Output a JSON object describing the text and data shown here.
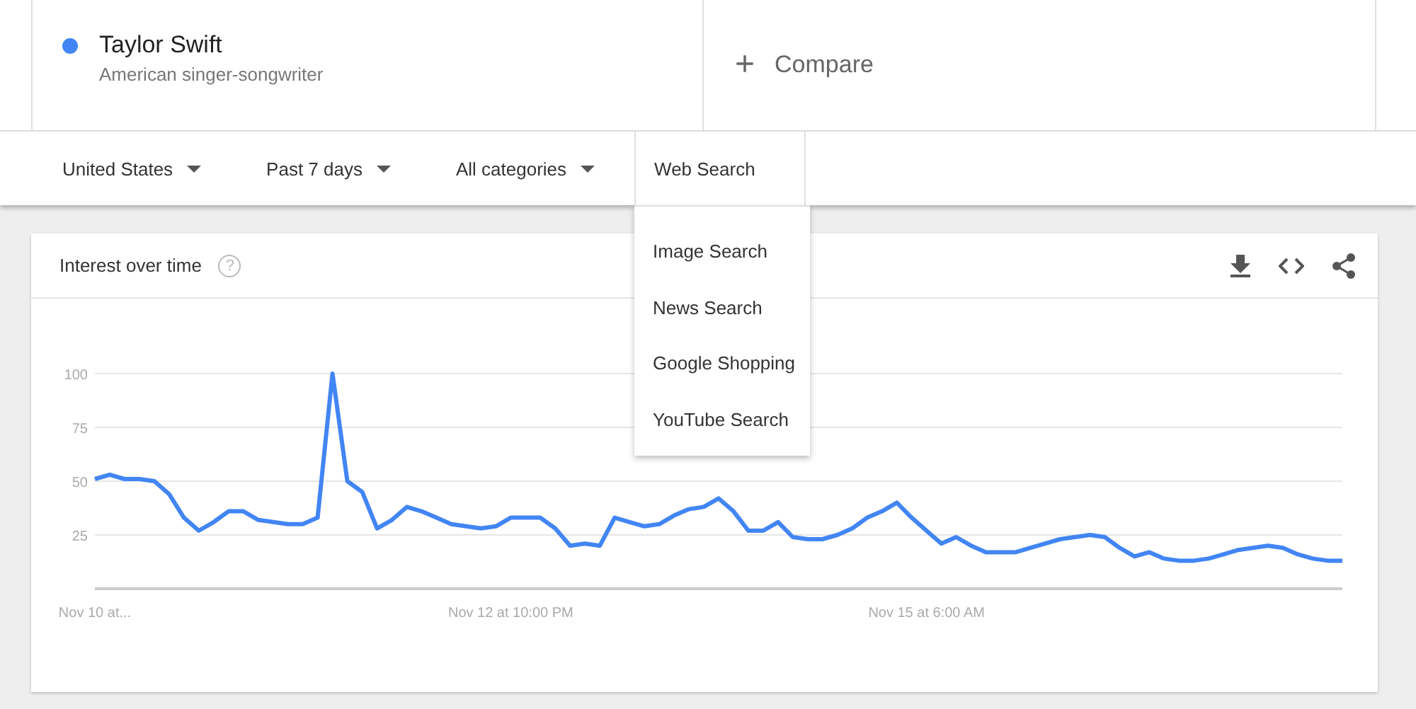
{
  "term": {
    "title": "Taylor Swift",
    "subtitle": "American singer-songwriter",
    "color": "#4285f4"
  },
  "compare": {
    "label": "Compare",
    "icon": "+"
  },
  "filters": [
    {
      "label": "United States"
    },
    {
      "label": "Past 7 days"
    },
    {
      "label": "All categories"
    }
  ],
  "search_type": {
    "value": "Web Search",
    "expanded": true,
    "options": [
      {
        "label": "Image Search",
        "selected": false
      },
      {
        "label": "News Search",
        "selected": false
      },
      {
        "label": "Google Shopping",
        "selected": false
      },
      {
        "label": "YouTube Search",
        "selected": false
      }
    ]
  },
  "card": {
    "title": "Interest over time",
    "help_icon": "?",
    "chart_data": {
      "type": "line",
      "categories": [
        "Nov 10 at...",
        null,
        null,
        null,
        null,
        null,
        null,
        null,
        null,
        null,
        null,
        null,
        null,
        null,
        null,
        null,
        null,
        null,
        null,
        null,
        null,
        null,
        null,
        null,
        null,
        null,
        null,
        null,
        "Nov 12 at 10:00 PM",
        null,
        null,
        null,
        null,
        null,
        null,
        null,
        null,
        null,
        null,
        null,
        null,
        null,
        null,
        null,
        null,
        null,
        null,
        null,
        null,
        null,
        null,
        null,
        null,
        null,
        null,
        null,
        "Nov 15 at 6:00 AM",
        null,
        null,
        null,
        null,
        null,
        null,
        null,
        null,
        null,
        null,
        null,
        null,
        null,
        null,
        null,
        null,
        null,
        null,
        null,
        null,
        null,
        null,
        null,
        null,
        null,
        null,
        null,
        null
      ],
      "series": [
        {
          "color": "#4285f4",
          "values": [
            51,
            53,
            51,
            51,
            50,
            44,
            33,
            27,
            31,
            36,
            36,
            32,
            31,
            30,
            30,
            33,
            100,
            50,
            45,
            28,
            32,
            38,
            36,
            33,
            30,
            29,
            28,
            29,
            33,
            33,
            33,
            28,
            20,
            21,
            20,
            33,
            31,
            29,
            30,
            34,
            37,
            38,
            42,
            36,
            27,
            27,
            31,
            24,
            23,
            23,
            25,
            28,
            33,
            36,
            40,
            33,
            27,
            21,
            24,
            20,
            17,
            17,
            17,
            19,
            21,
            23,
            24,
            25,
            24,
            19,
            15,
            17,
            14,
            13,
            13,
            14,
            16,
            18,
            19,
            20,
            19,
            16,
            14,
            13,
            13
          ]
        }
      ],
      "ylim": [
        0,
        100
      ],
      "grid": true,
      "yticks": [
        25,
        50,
        75,
        100
      ]
    }
  }
}
